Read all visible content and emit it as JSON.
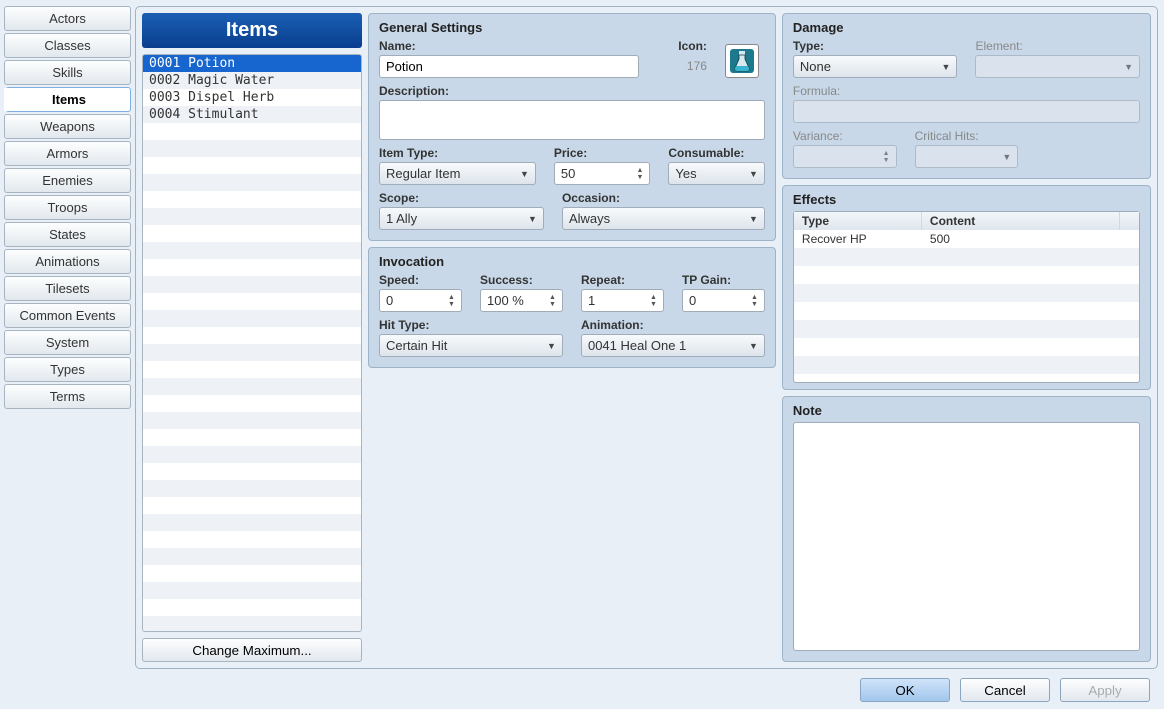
{
  "sidebar": {
    "tabs": [
      "Actors",
      "Classes",
      "Skills",
      "Items",
      "Weapons",
      "Armors",
      "Enemies",
      "Troops",
      "States",
      "Animations",
      "Tilesets",
      "Common Events",
      "System",
      "Types",
      "Terms"
    ],
    "active_index": 3
  },
  "item_panel": {
    "title": "Items",
    "items": [
      {
        "id": "0001",
        "name": "Potion"
      },
      {
        "id": "0002",
        "name": "Magic Water"
      },
      {
        "id": "0003",
        "name": "Dispel Herb"
      },
      {
        "id": "0004",
        "name": "Stimulant"
      }
    ],
    "selected_index": 0,
    "change_max_label": "Change Maximum..."
  },
  "general": {
    "title": "General Settings",
    "name_label": "Name:",
    "name_value": "Potion",
    "icon_label": "Icon:",
    "icon_index": "176",
    "desc_label": "Description:",
    "desc_value": "",
    "item_type_label": "Item Type:",
    "item_type_value": "Regular Item",
    "price_label": "Price:",
    "price_value": "50",
    "consumable_label": "Consumable:",
    "consumable_value": "Yes",
    "scope_label": "Scope:",
    "scope_value": "1 Ally",
    "occasion_label": "Occasion:",
    "occasion_value": "Always"
  },
  "invocation": {
    "title": "Invocation",
    "speed_label": "Speed:",
    "speed_value": "0",
    "success_label": "Success:",
    "success_value": "100 %",
    "repeat_label": "Repeat:",
    "repeat_value": "1",
    "tpgain_label": "TP Gain:",
    "tpgain_value": "0",
    "hittype_label": "Hit Type:",
    "hittype_value": "Certain Hit",
    "animation_label": "Animation:",
    "animation_value": "0041 Heal One 1"
  },
  "damage": {
    "title": "Damage",
    "type_label": "Type:",
    "type_value": "None",
    "element_label": "Element:",
    "element_value": "",
    "formula_label": "Formula:",
    "formula_value": "",
    "variance_label": "Variance:",
    "variance_value": "",
    "crit_label": "Critical Hits:",
    "crit_value": ""
  },
  "effects": {
    "title": "Effects",
    "headers": {
      "type": "Type",
      "content": "Content"
    },
    "rows": [
      {
        "type": "Recover HP",
        "content": "500"
      }
    ]
  },
  "note": {
    "title": "Note",
    "value": ""
  },
  "footer": {
    "ok": "OK",
    "cancel": "Cancel",
    "apply": "Apply"
  }
}
